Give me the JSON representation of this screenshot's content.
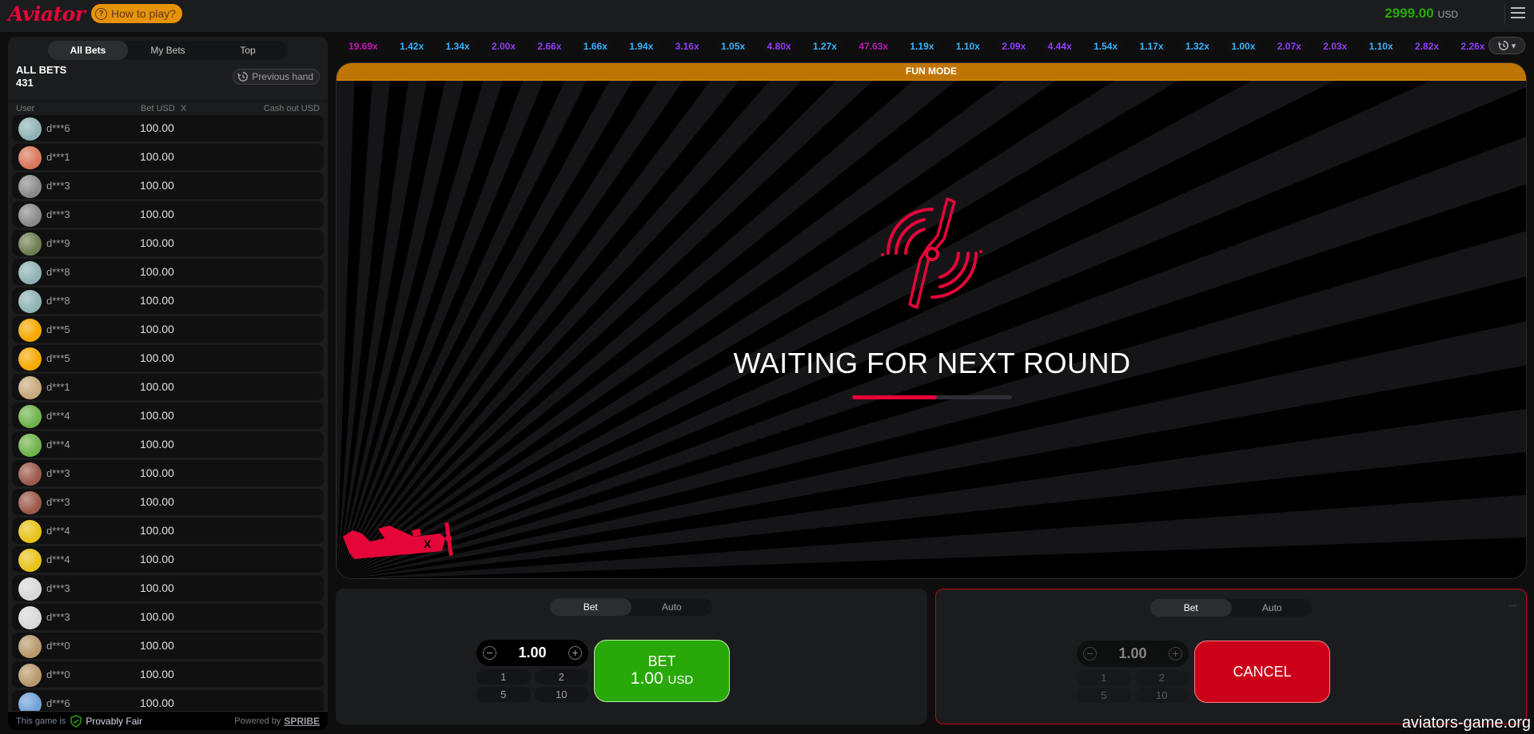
{
  "header": {
    "logo": "Aviator",
    "how_to_play": "How to play?",
    "balance": "2999.00",
    "currency": "USD"
  },
  "sidebar": {
    "tabs": [
      {
        "label": "All Bets",
        "active": true
      },
      {
        "label": "My Bets",
        "active": false
      },
      {
        "label": "Top",
        "active": false
      }
    ],
    "title": "ALL BETS",
    "count": "431",
    "previous_hand": "Previous hand",
    "columns": {
      "user": "User",
      "bet": "Bet USD",
      "x": "X",
      "cashout": "Cash out USD"
    },
    "rows": [
      {
        "user": "d***6",
        "bet": "100.00",
        "avatar": "#8fb3b5"
      },
      {
        "user": "d***1",
        "bet": "100.00",
        "avatar": "#d9785a"
      },
      {
        "user": "d***3",
        "bet": "100.00",
        "avatar": "#8a8a8a"
      },
      {
        "user": "d***3",
        "bet": "100.00",
        "avatar": "#8a8a8a"
      },
      {
        "user": "d***9",
        "bet": "100.00",
        "avatar": "#6e7f52"
      },
      {
        "user": "d***8",
        "bet": "100.00",
        "avatar": "#8fb3b5"
      },
      {
        "user": "d***8",
        "bet": "100.00",
        "avatar": "#8fb3b5"
      },
      {
        "user": "d***5",
        "bet": "100.00",
        "avatar": "#f5a800"
      },
      {
        "user": "d***5",
        "bet": "100.00",
        "avatar": "#f5a800"
      },
      {
        "user": "d***1",
        "bet": "100.00",
        "avatar": "#c9a87c"
      },
      {
        "user": "d***4",
        "bet": "100.00",
        "avatar": "#6fb34a"
      },
      {
        "user": "d***4",
        "bet": "100.00",
        "avatar": "#6fb34a"
      },
      {
        "user": "d***3",
        "bet": "100.00",
        "avatar": "#9c5a4a"
      },
      {
        "user": "d***3",
        "bet": "100.00",
        "avatar": "#9c5a4a"
      },
      {
        "user": "d***4",
        "bet": "100.00",
        "avatar": "#e8c31a"
      },
      {
        "user": "d***4",
        "bet": "100.00",
        "avatar": "#e8c31a"
      },
      {
        "user": "d***3",
        "bet": "100.00",
        "avatar": "#d8d8d8"
      },
      {
        "user": "d***3",
        "bet": "100.00",
        "avatar": "#d8d8d8"
      },
      {
        "user": "d***0",
        "bet": "100.00",
        "avatar": "#b8996c"
      },
      {
        "user": "d***0",
        "bet": "100.00",
        "avatar": "#b8996c"
      },
      {
        "user": "d***6",
        "bet": "100.00",
        "avatar": "#6fa0d8"
      }
    ],
    "footer": {
      "this_game_is": "This game is",
      "provably_fair": "Provably Fair",
      "powered_by": "Powered by",
      "brand": "SPRIBE"
    }
  },
  "multipliers": [
    {
      "v": "19.69x",
      "c": "#c017b4"
    },
    {
      "v": "1.42x",
      "c": "#34b4ff"
    },
    {
      "v": "1.34x",
      "c": "#34b4ff"
    },
    {
      "v": "2.00x",
      "c": "#913ef8"
    },
    {
      "v": "2.66x",
      "c": "#913ef8"
    },
    {
      "v": "1.66x",
      "c": "#34b4ff"
    },
    {
      "v": "1.94x",
      "c": "#34b4ff"
    },
    {
      "v": "3.16x",
      "c": "#913ef8"
    },
    {
      "v": "1.05x",
      "c": "#34b4ff"
    },
    {
      "v": "4.80x",
      "c": "#913ef8"
    },
    {
      "v": "1.27x",
      "c": "#34b4ff"
    },
    {
      "v": "47.63x",
      "c": "#c017b4"
    },
    {
      "v": "1.19x",
      "c": "#34b4ff"
    },
    {
      "v": "1.10x",
      "c": "#34b4ff"
    },
    {
      "v": "2.09x",
      "c": "#913ef8"
    },
    {
      "v": "4.44x",
      "c": "#913ef8"
    },
    {
      "v": "1.54x",
      "c": "#34b4ff"
    },
    {
      "v": "1.17x",
      "c": "#34b4ff"
    },
    {
      "v": "1.32x",
      "c": "#34b4ff"
    },
    {
      "v": "1.00x",
      "c": "#34b4ff"
    },
    {
      "v": "2.07x",
      "c": "#913ef8"
    },
    {
      "v": "2.03x",
      "c": "#913ef8"
    },
    {
      "v": "1.10x",
      "c": "#34b4ff"
    },
    {
      "v": "2.82x",
      "c": "#913ef8"
    },
    {
      "v": "2.26x",
      "c": "#913ef8"
    }
  ],
  "game": {
    "mode_banner": "FUN MODE",
    "status": "WAITING FOR NEXT ROUND",
    "progress_percent": 53,
    "accent": "#e50539"
  },
  "bet_panels": [
    {
      "tabs": [
        {
          "label": "Bet",
          "active": true
        },
        {
          "label": "Auto",
          "active": false
        }
      ],
      "amount": "1.00",
      "quick": [
        "1",
        "2",
        "5",
        "10"
      ],
      "button_line1": "BET",
      "button_amount": "1.00",
      "button_currency": "USD"
    },
    {
      "tabs": [
        {
          "label": "Bet",
          "active": true
        },
        {
          "label": "Auto",
          "active": false
        }
      ],
      "amount": "1.00",
      "quick": [
        "1",
        "2",
        "5",
        "10"
      ],
      "button_label": "CANCEL"
    }
  ],
  "watermark": "aviators-game.org"
}
